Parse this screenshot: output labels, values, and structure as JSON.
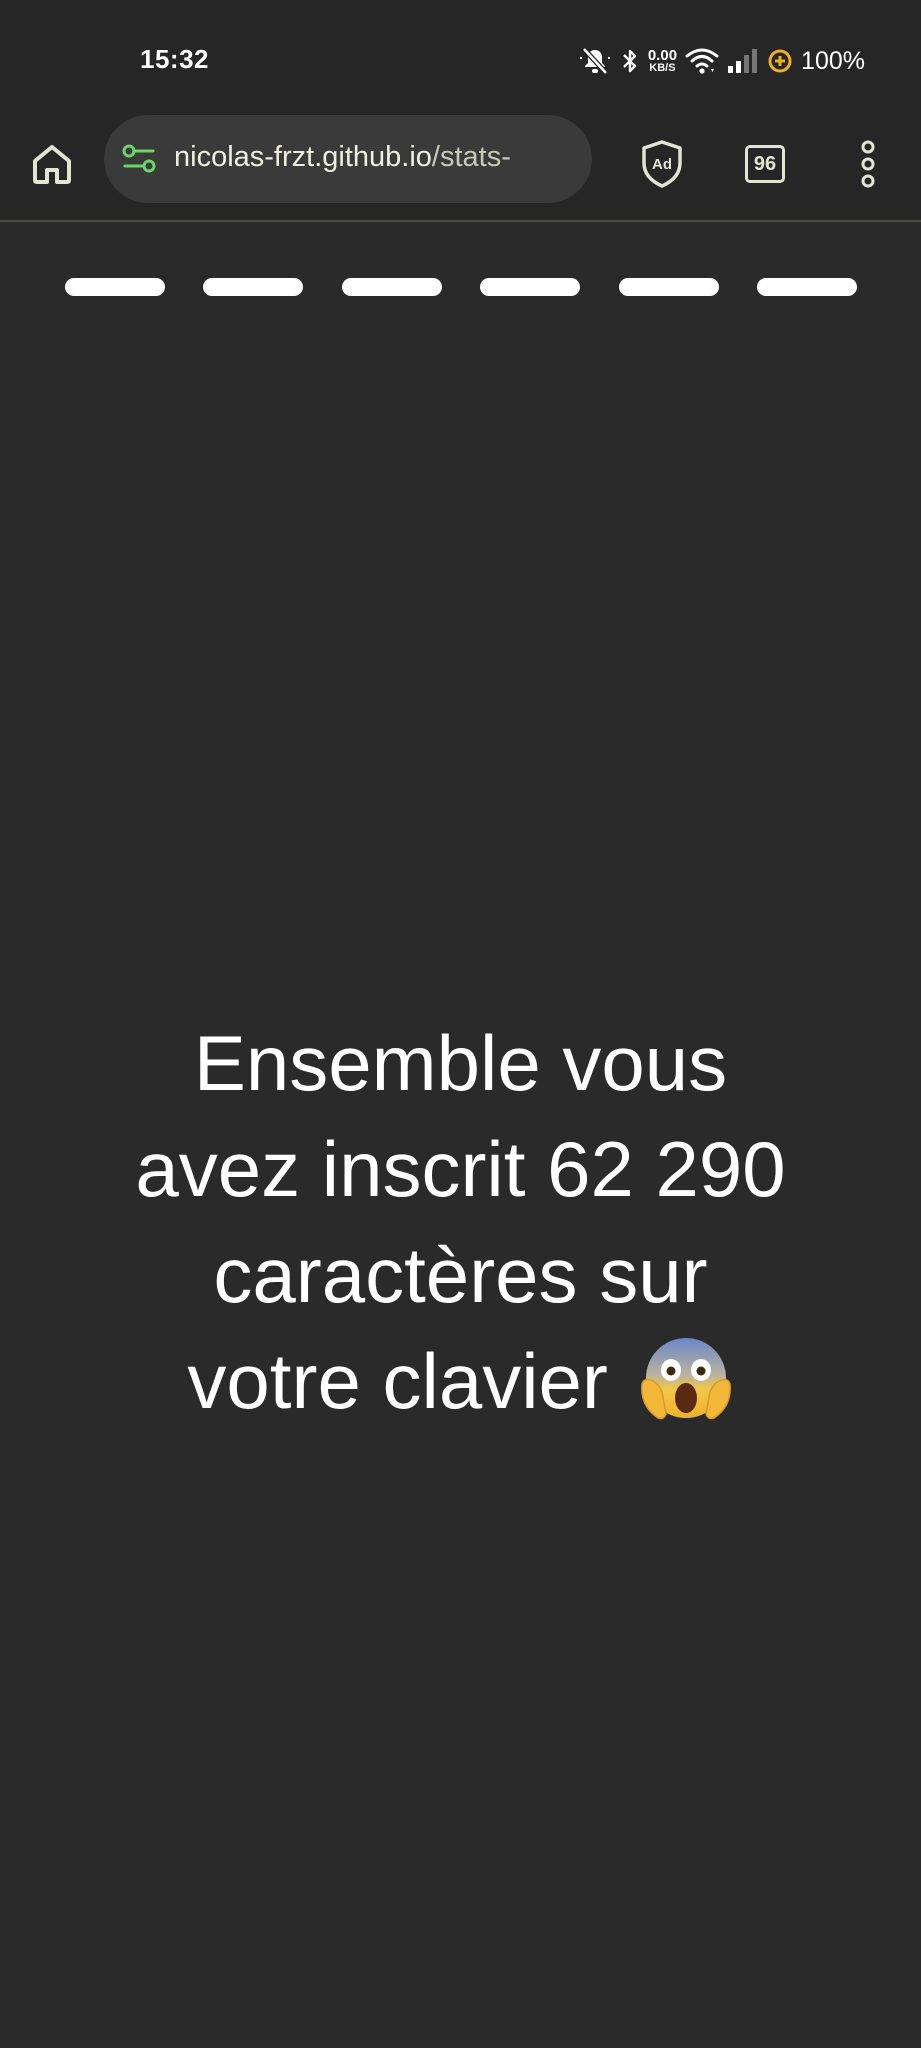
{
  "status_bar": {
    "time": "15:32",
    "net_speed_value": "0.00",
    "net_speed_unit": "KB/S",
    "battery": "100%",
    "icons": [
      "mute-icon",
      "bluetooth-icon",
      "wifi-icon",
      "signal-icon",
      "battery-saver-icon"
    ]
  },
  "browser": {
    "url_host": "nicolas-frzt.github.io",
    "url_path": "/stats-",
    "tabs_count": "96",
    "icons": [
      "home-icon",
      "site-settings-icon",
      "ad-block-shield-icon",
      "tabs-icon",
      "more-menu-icon"
    ]
  },
  "story": {
    "segments_total": 6,
    "lines": [
      "Ensemble vous",
      "avez inscrit 62 290",
      "caractères sur",
      "votre clavier"
    ],
    "emoji": "screaming-face-emoji"
  },
  "colors": {
    "background": "#2a2a2a",
    "toolbar": "#262626",
    "accent_green": "#6cd46a",
    "battery_saver": "#f0b020"
  }
}
